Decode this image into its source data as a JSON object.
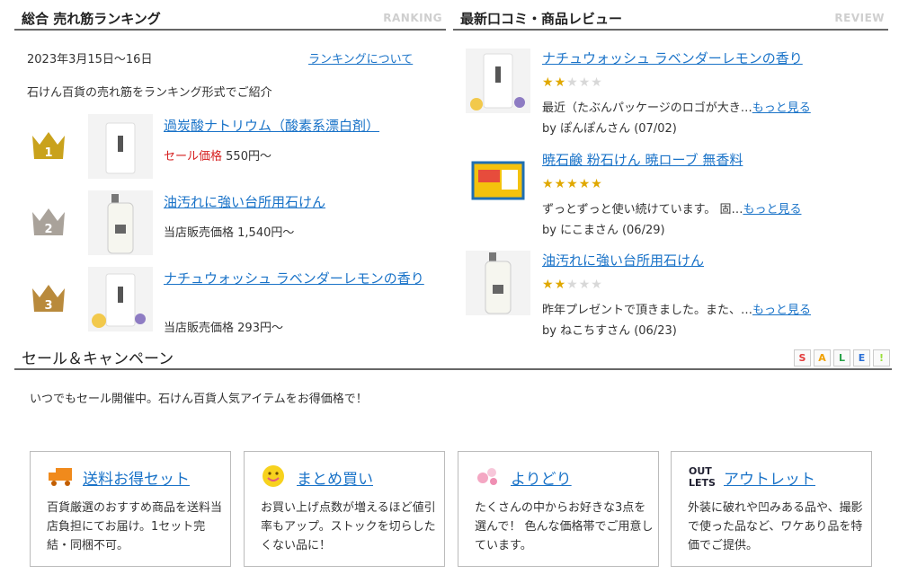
{
  "ranking": {
    "title": "総合 売れ筋ランキング",
    "sub": "RANKING",
    "date": "2023年3月15日〜16日",
    "about_link": "ランキングについて",
    "intro": "石けん百貨の売れ筋をランキング形式でご紹介",
    "items": [
      {
        "rank": "1",
        "name": "過炭酸ナトリウム（酸素系漂白剤）",
        "price_label": "セール価格",
        "price": "550円〜"
      },
      {
        "rank": "2",
        "name": "油汚れに強い台所用石けん",
        "price_label": "当店販売価格",
        "price": "1,540円〜"
      },
      {
        "rank": "3",
        "name": "ナチュウォッシュ ラベンダーレモンの香り",
        "price_label": "当店販売価格",
        "price": "293円〜"
      }
    ],
    "crown_colors": [
      "#c9a21c",
      "#a9a29a",
      "#b98a3c"
    ]
  },
  "reviews": {
    "title": "最新口コミ・商品レビュー",
    "sub": "REVIEW",
    "more": "もっと見る",
    "items": [
      {
        "name": "ナチュウォッシュ ラベンダーレモンの香り",
        "rating": 2,
        "text": "最近（たぶんパッケージのロゴが大き…",
        "by": "by ぽんぽんさん (07/02)"
      },
      {
        "name": "暁石鹸 粉石けん 暁ローブ 無香料",
        "rating": 5,
        "text": "ずっとずっと使い続けています。 固…",
        "by": "by にこまさん (06/29)"
      },
      {
        "name": "油汚れに強い台所用石けん",
        "rating": 2,
        "text": "昨年プレゼントで頂きました。また、…",
        "by": "by ねこちすさん (06/23)"
      }
    ]
  },
  "sale": {
    "title": "セール＆キャンペーン",
    "badges": [
      "S",
      "A",
      "L",
      "E",
      "!"
    ],
    "badge_colors": [
      "#e23b3b",
      "#f0a000",
      "#2aa24a",
      "#2a6fd6",
      "#9adf3a"
    ],
    "intro": "いつでもセール開催中。石けん百貨人気アイテムをお得価格で！",
    "cards": [
      {
        "icon": "truck-icon",
        "title": "送料お得セット",
        "desc": "百貨厳選のおすすめ商品を送料当店負担にてお届け。1セット完結・同梱不可。"
      },
      {
        "icon": "smiley-icon",
        "title": "まとめ買い",
        "desc": "お買い上げ点数が増えるほど値引率もアップ。ストックを切らしたくない品に！"
      },
      {
        "icon": "bubbles-icon",
        "title": "よりどり",
        "desc": "たくさんの中からお好きな3点を選んで！ 色んな価格帯でご用意しています。"
      },
      {
        "icon": "outlets-icon",
        "title": "アウトレット",
        "desc": "外装に破れや凹みある品や、撮影で使った品など、ワケあり品を特価でご提供。"
      }
    ]
  }
}
